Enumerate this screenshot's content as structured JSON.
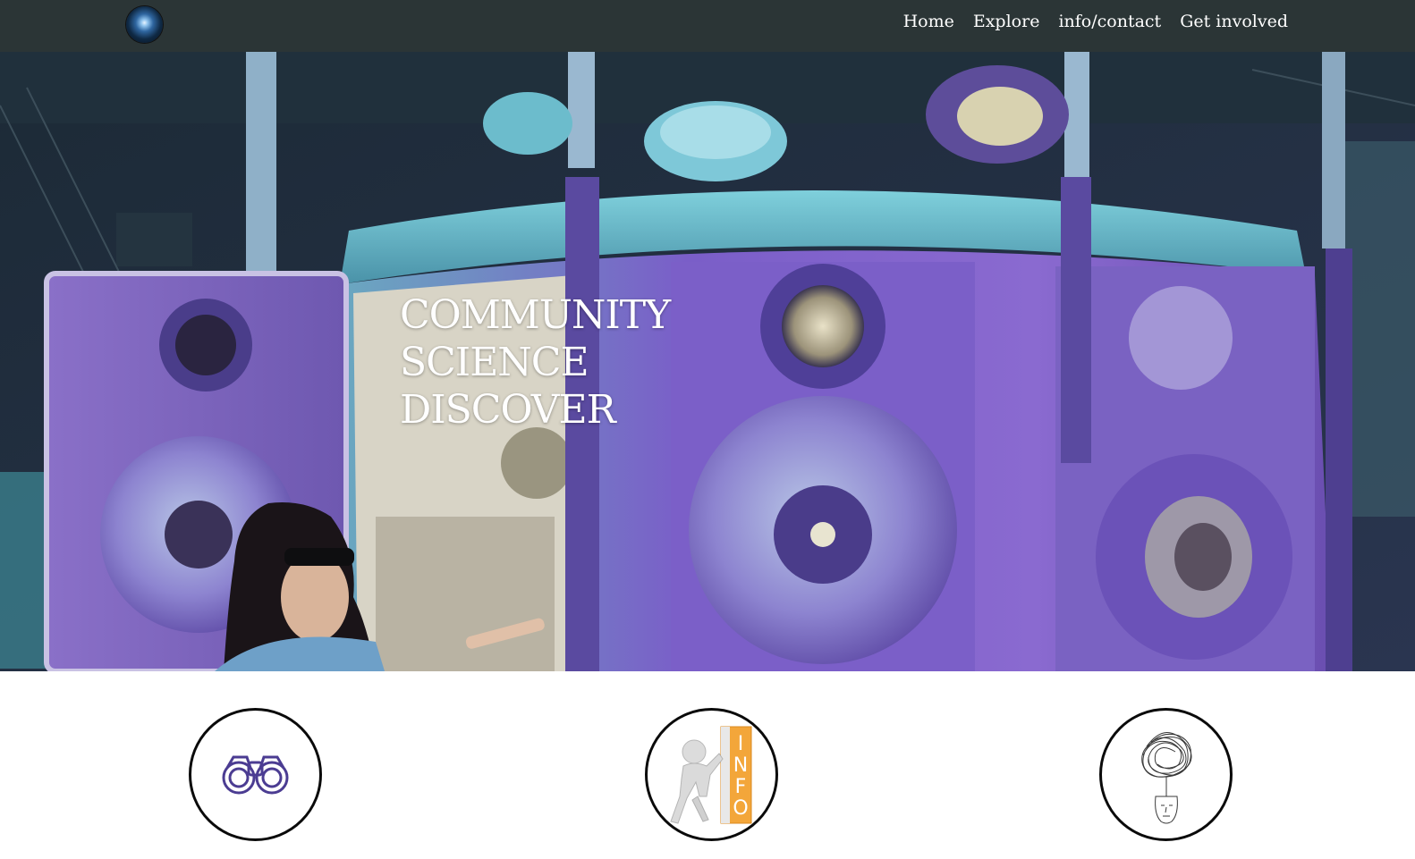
{
  "nav": {
    "logo_icon": "glowing-orb-logo-icon",
    "links": [
      {
        "label": "Home"
      },
      {
        "label": "Explore"
      },
      {
        "label": "info/contact"
      },
      {
        "label": "Get involved"
      }
    ]
  },
  "hero": {
    "title_lines": [
      "COMMUNITY",
      "SCIENCE",
      "DISCOVER"
    ],
    "image": "scientist-vacuum-chamber-photo"
  },
  "features": [
    {
      "icon": "binoculars-icon"
    },
    {
      "icon": "info-figure-icon",
      "label": "INFO"
    },
    {
      "icon": "tangled-thought-head-icon"
    }
  ],
  "colors": {
    "nav_bg": "#2b3536",
    "chamber_purple": "#7b5cc4",
    "chamber_teal": "#5fb6c7",
    "info_orange": "#f0a030"
  }
}
